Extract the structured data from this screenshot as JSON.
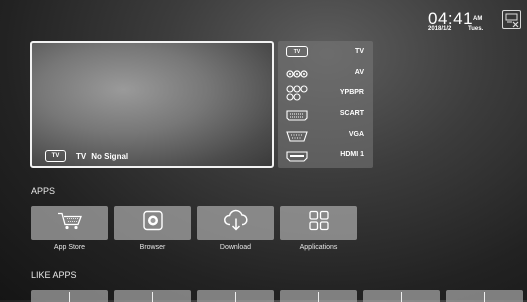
{
  "status_bar": {
    "time": "04:41",
    "ampm": "AM",
    "date": "2018/1/2",
    "weekday": "Tues.",
    "icon": "screen-cast-icon"
  },
  "preview": {
    "badge": "TV",
    "source": "TV",
    "signal": "No Signal"
  },
  "sources": [
    {
      "label": "TV",
      "icon": "tv-icon",
      "badge": "TV"
    },
    {
      "label": "AV",
      "icon": "av-jacks-icon"
    },
    {
      "label": "YPBPR",
      "icon": "component-jacks-icon"
    },
    {
      "label": "SCART",
      "icon": "scart-port-icon"
    },
    {
      "label": "VGA",
      "icon": "vga-port-icon"
    },
    {
      "label": "HDMI 1",
      "icon": "hdmi-port-icon"
    }
  ],
  "apps_section": {
    "title": "APPS",
    "items": [
      {
        "label": "App Store",
        "icon": "shopping-cart-icon"
      },
      {
        "label": "Browser",
        "icon": "browser-globe-icon"
      },
      {
        "label": "Download",
        "icon": "cloud-download-icon"
      },
      {
        "label": "Applications",
        "icon": "app-grid-icon"
      }
    ]
  },
  "like_apps_section": {
    "title": "LIKE APPS"
  }
}
